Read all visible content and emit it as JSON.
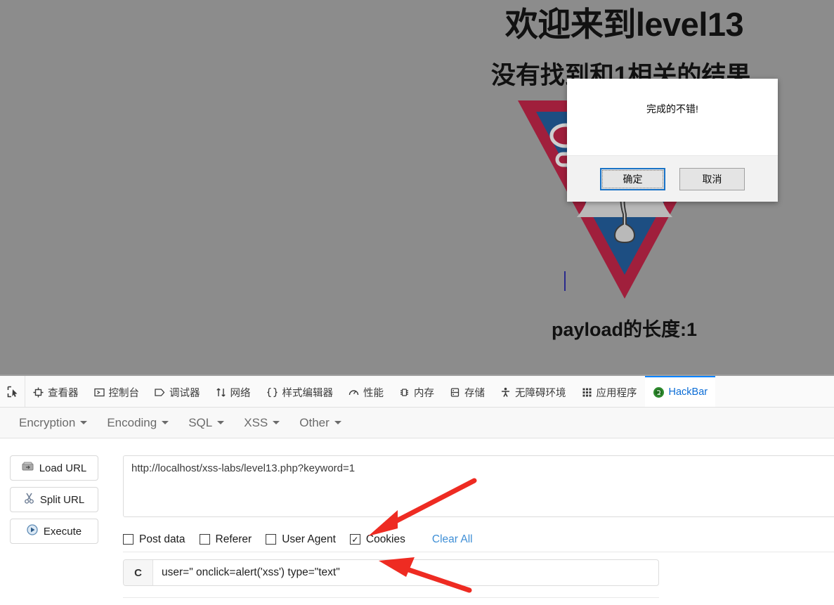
{
  "page": {
    "heading": "欢迎来到level13",
    "subheading": "没有找到和1相关的结果.",
    "payload_length": "payload的长度:1",
    "background_color": "#8c8c8c",
    "logo_alt": "liberty-bell-level-logo"
  },
  "dialog": {
    "message": "完成的不错!",
    "ok_label": "确定",
    "cancel_label": "取消"
  },
  "devtools": {
    "picker_icon": "element-picker-icon",
    "tabs": [
      {
        "label": "查看器",
        "icon": "inspector-icon",
        "active": false
      },
      {
        "label": "控制台",
        "icon": "console-icon",
        "active": false
      },
      {
        "label": "调试器",
        "icon": "debugger-icon",
        "active": false
      },
      {
        "label": "网络",
        "icon": "network-icon",
        "active": false
      },
      {
        "label": "样式编辑器",
        "icon": "style-editor-icon",
        "active": false
      },
      {
        "label": "性能",
        "icon": "performance-icon",
        "active": false
      },
      {
        "label": "内存",
        "icon": "memory-icon",
        "active": false
      },
      {
        "label": "存储",
        "icon": "storage-icon",
        "active": false
      },
      {
        "label": "无障碍环境",
        "icon": "accessibility-icon",
        "active": false
      },
      {
        "label": "应用程序",
        "icon": "application-icon",
        "active": false
      },
      {
        "label": "HackBar",
        "icon": "hackbar-icon",
        "active": true
      }
    ],
    "active_tab_color": "#0a84ff"
  },
  "hackbar": {
    "menus": [
      {
        "label": "Encryption"
      },
      {
        "label": "Encoding"
      },
      {
        "label": "SQL"
      },
      {
        "label": "XSS"
      },
      {
        "label": "Other"
      }
    ],
    "buttons": [
      {
        "label": "Load URL",
        "icon": "load-url-icon"
      },
      {
        "label": "Split URL",
        "icon": "split-url-icon"
      },
      {
        "label": "Execute",
        "icon": "execute-icon"
      }
    ],
    "url": {
      "value": "http://localhost/xss-labs/level13.php?keyword=1",
      "placeholder": "URL"
    },
    "checkboxes": [
      {
        "label": "Post data",
        "checked": false
      },
      {
        "label": "Referer",
        "checked": false
      },
      {
        "label": "User Agent",
        "checked": false
      },
      {
        "label": "Cookies",
        "checked": true
      }
    ],
    "clear_all_label": "Clear All",
    "clear_all_color": "#3f8fd6",
    "param": {
      "prefix": "C",
      "value": "user=\" onclick=alert('xss') type=\"text\"",
      "placeholder": ""
    }
  },
  "annotations": {
    "arrow_color": "#ee2b22",
    "arrows": [
      {
        "name": "arrow-to-cookies-checkbox"
      },
      {
        "name": "arrow-to-param-value"
      }
    ]
  }
}
